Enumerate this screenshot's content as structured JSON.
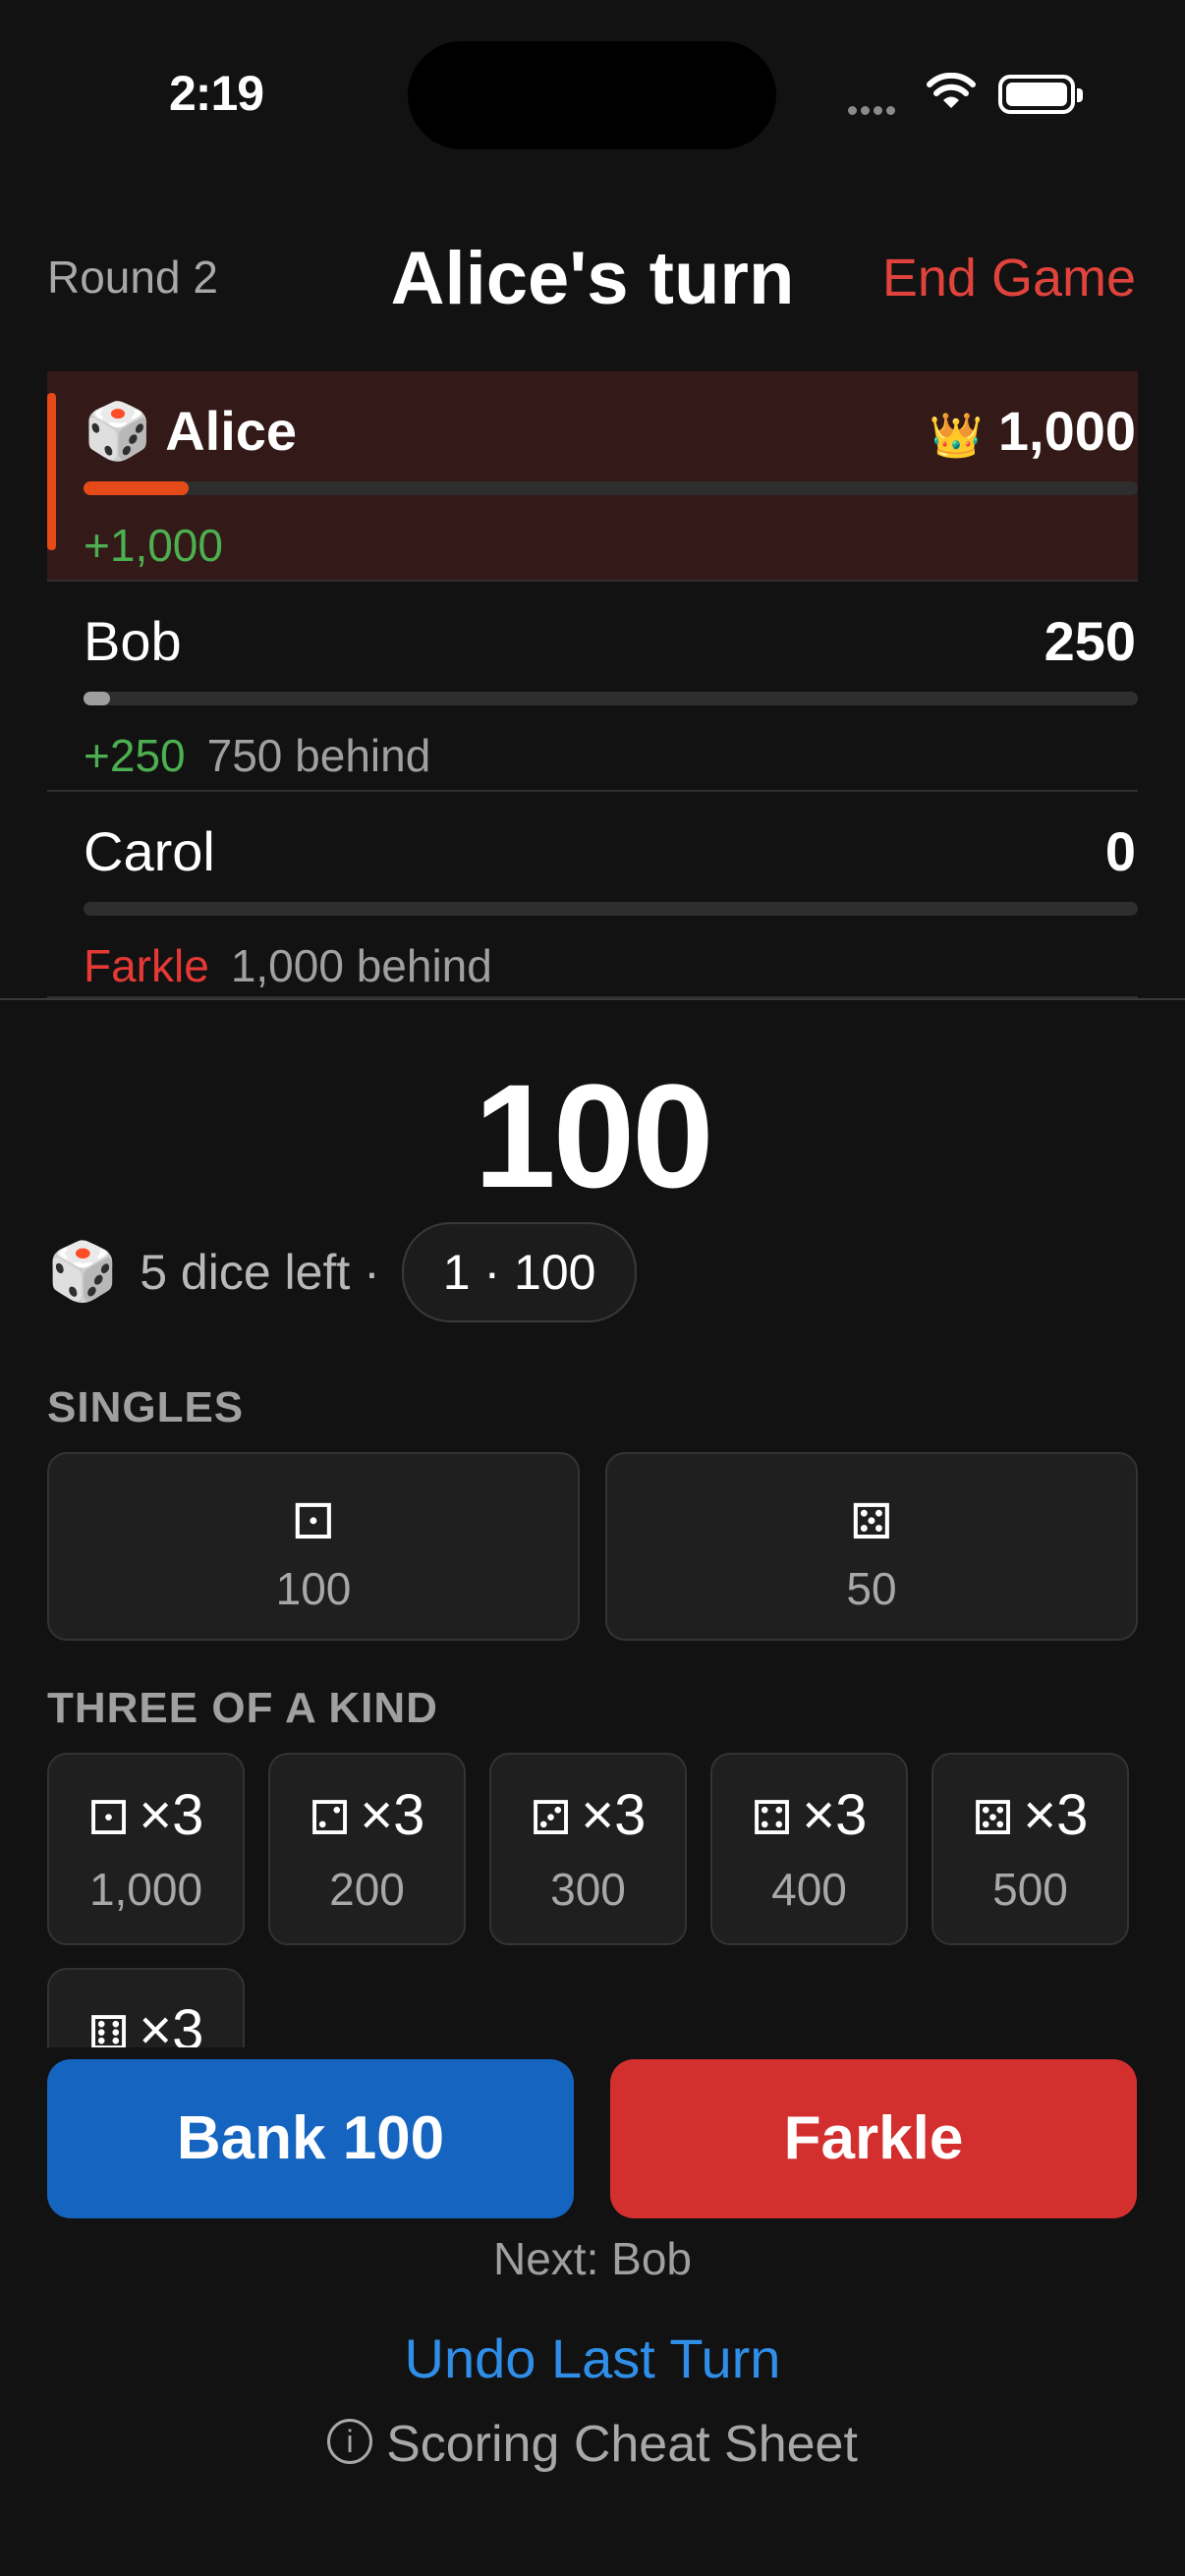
{
  "status_bar": {
    "time": "2:19"
  },
  "header": {
    "round": "Round 2",
    "title": "Alice's turn",
    "end_game": "End Game"
  },
  "players": [
    {
      "icon": "🎲",
      "name": "Alice",
      "crown": "👑",
      "score": "1,000",
      "change": "+1,000",
      "behind": "",
      "progress": 0.1,
      "active": true
    },
    {
      "icon": "",
      "name": "Bob",
      "crown": "",
      "score": "250",
      "change": "+250",
      "behind": "750 behind",
      "progress": 0.025,
      "active": false
    },
    {
      "icon": "",
      "name": "Carol",
      "crown": "",
      "score": "0",
      "change": "Farkle",
      "behind": "1,000 behind",
      "progress": 0,
      "active": false
    }
  ],
  "turn": {
    "score": "100",
    "dice_icon": "🎲",
    "dice_left": "5 dice left ·",
    "history_pill": "1 · 100"
  },
  "singles": {
    "label": "SINGLES",
    "items": [
      {
        "face": "⚀",
        "value": "100"
      },
      {
        "face": "⚄",
        "value": "50"
      }
    ]
  },
  "three_of_a_kind": {
    "label": "THREE OF A KIND",
    "items": [
      {
        "face": "⚀",
        "mult": "×3",
        "value": "1,000"
      },
      {
        "face": "⚁",
        "mult": "×3",
        "value": "200"
      },
      {
        "face": "⚂",
        "mult": "×3",
        "value": "300"
      },
      {
        "face": "⚃",
        "mult": "×3",
        "value": "400"
      },
      {
        "face": "⚄",
        "mult": "×3",
        "value": "500"
      },
      {
        "face": "⚅",
        "mult": "×3",
        "value": ""
      }
    ]
  },
  "actions": {
    "bank": "Bank 100",
    "farkle": "Farkle",
    "next": "Next: Bob",
    "undo": "Undo Last Turn",
    "cheat_sheet": "Scoring Cheat Sheet",
    "info_glyph": "i"
  }
}
